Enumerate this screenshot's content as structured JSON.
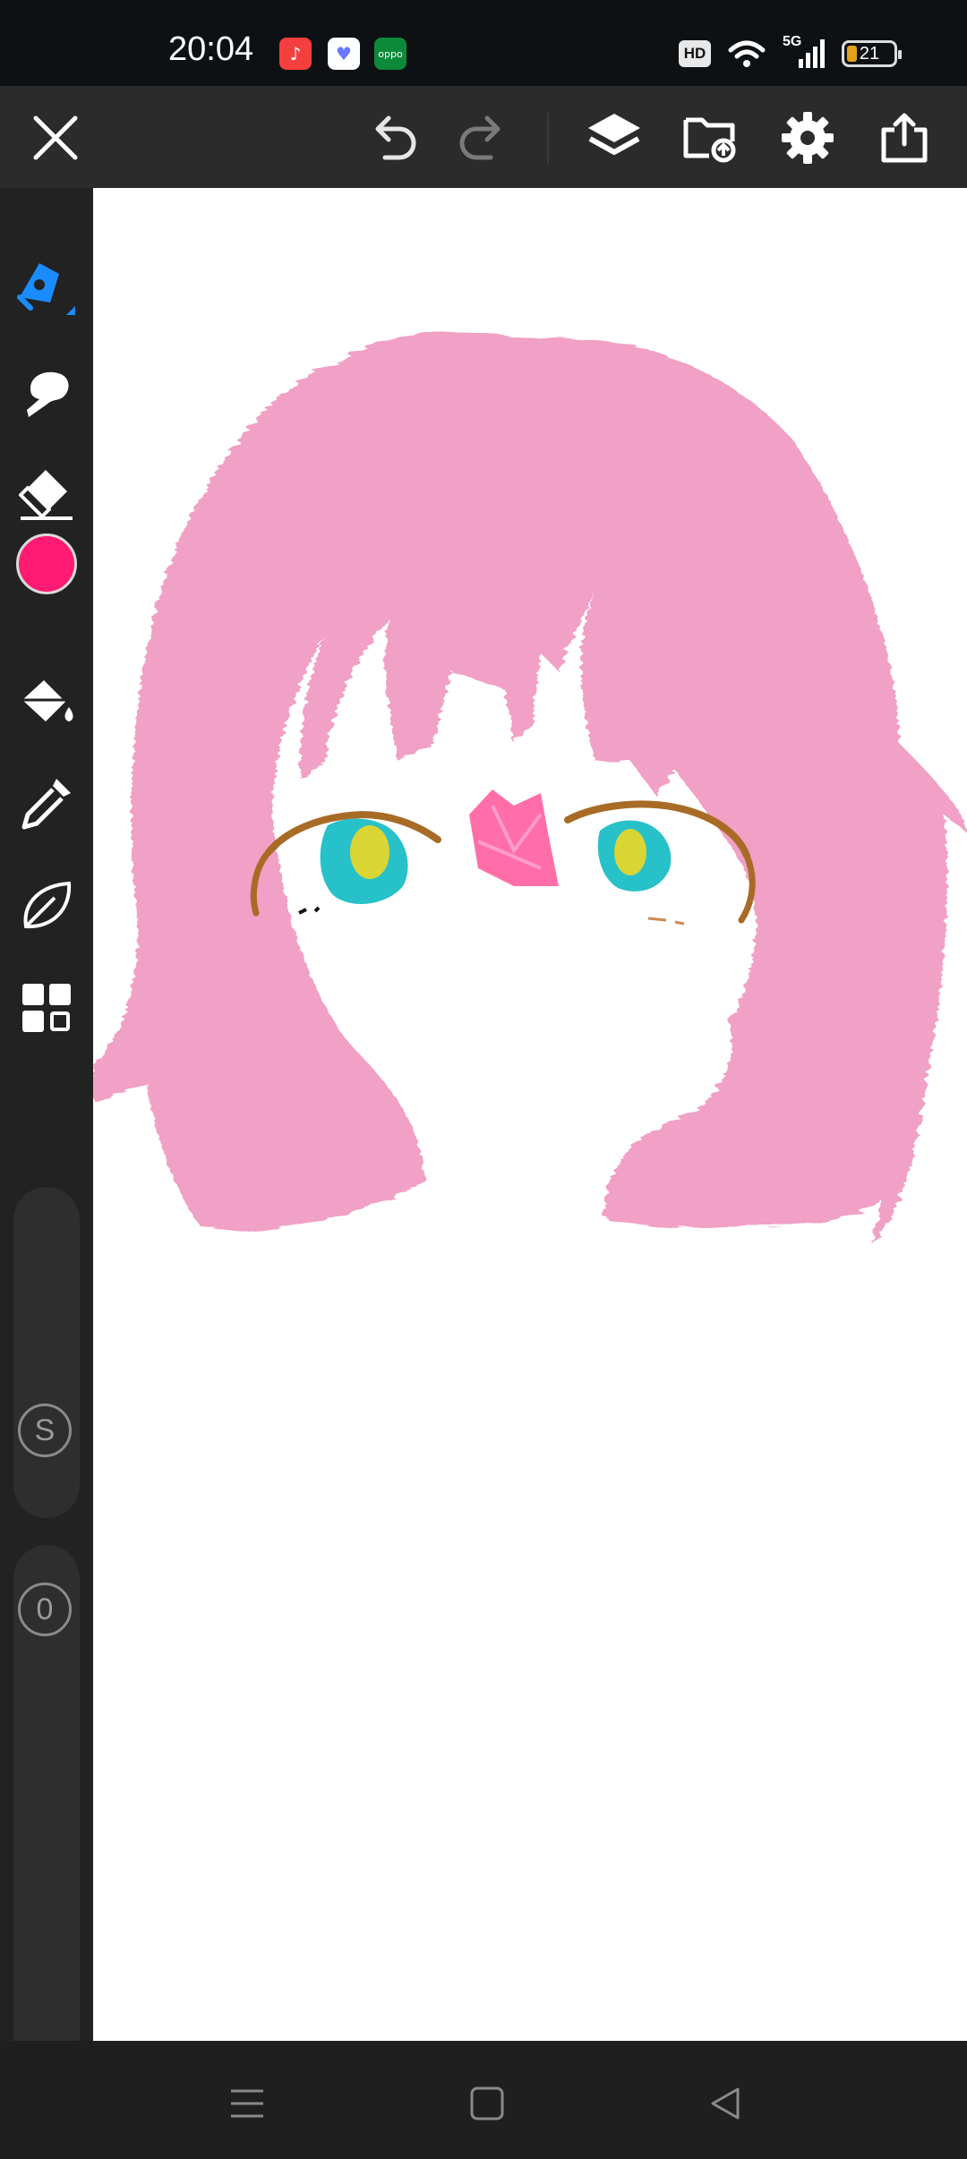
{
  "status_bar": {
    "time": "20:04",
    "apps": [
      {
        "name": "music-app-icon",
        "glyph": "♪",
        "color": "#f43f3f"
      },
      {
        "name": "health-app-icon",
        "glyph": "♥",
        "color": "#ffffff"
      },
      {
        "name": "oppo-app-icon",
        "glyph": "oppo",
        "color": "#0c8a3a"
      }
    ],
    "hd_label": "HD",
    "network_label": "5G",
    "battery_level": "21"
  },
  "toolbar": {
    "icons": [
      "close-icon",
      "undo-icon",
      "redo-icon",
      "layers-icon",
      "import-icon",
      "settings-icon",
      "export-icon"
    ]
  },
  "sidebar": {
    "tools": [
      "pen-icon",
      "smudge-icon",
      "eraser-icon",
      "fill-bucket-icon",
      "eyedropper-icon",
      "leaf-icon",
      "grid-icon"
    ],
    "current_color": "#ff1a73",
    "size_label": "S",
    "opacity_label": "0"
  },
  "colors": {
    "hair": "#f1a0c6",
    "eye_teal": "#27c1c9",
    "eye_yellow": "#d9d535",
    "lash_brown": "#a86b26",
    "gem_pink": "#ff6ea8",
    "accent_blue": "#1a8cff"
  },
  "navbar": {
    "icons": [
      "menu-icon",
      "home-icon",
      "back-icon"
    ]
  }
}
